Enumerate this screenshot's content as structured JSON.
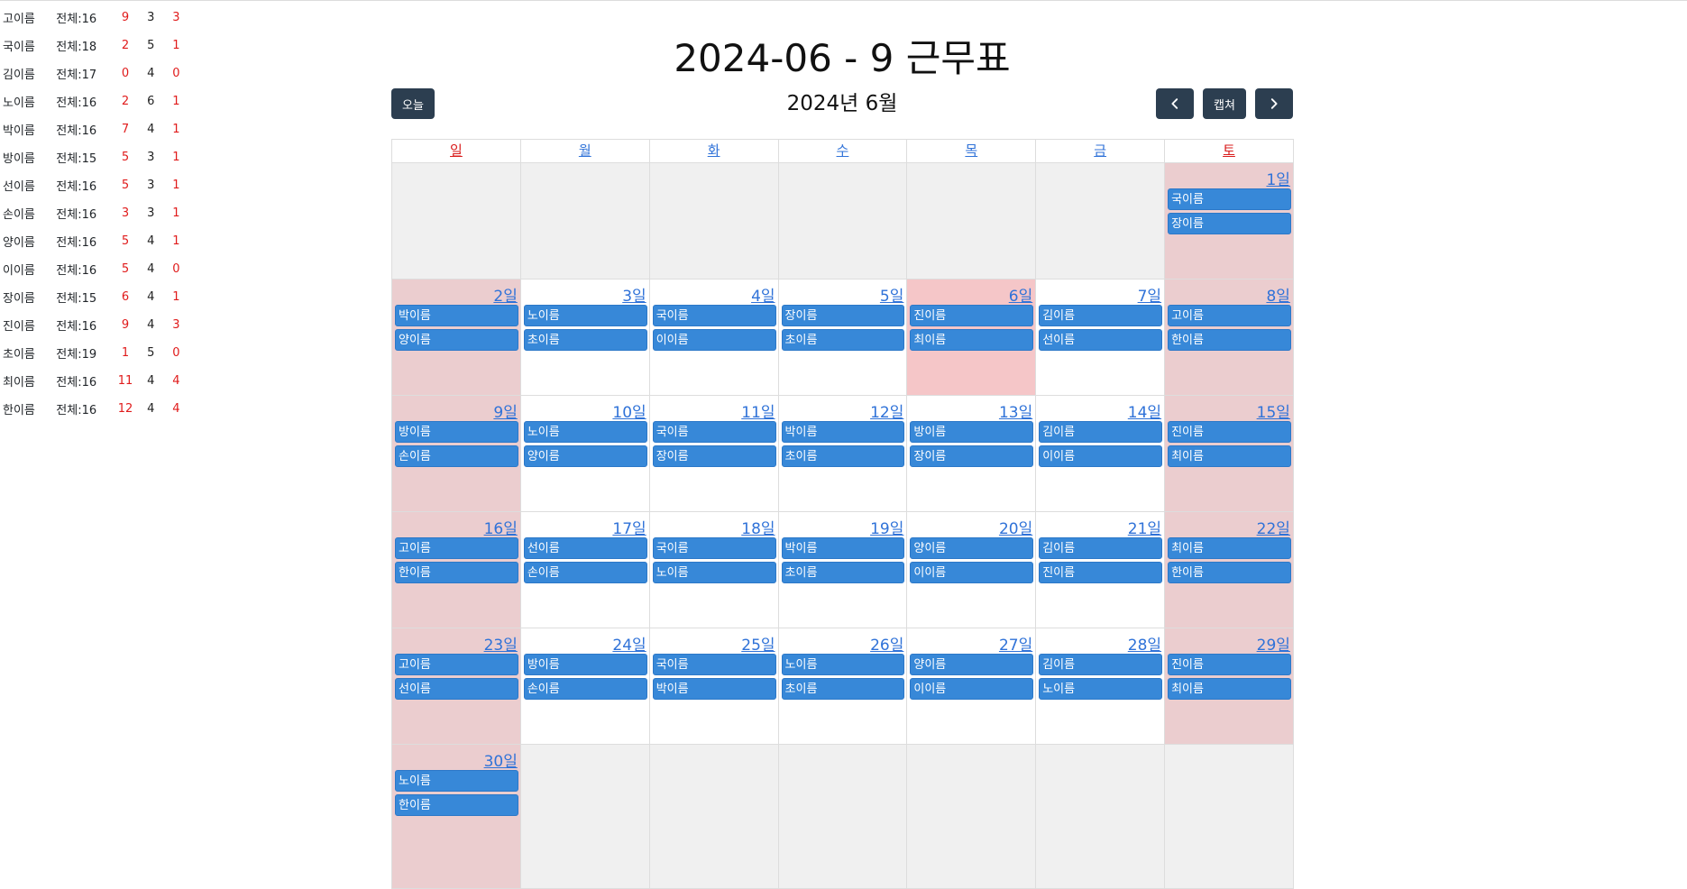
{
  "page": {
    "title": "2024-06 - 9 근무표"
  },
  "toolbar": {
    "today": "오늘",
    "capture": "캡쳐",
    "month_title": "2024년 6월"
  },
  "stats": [
    {
      "name": "고이름",
      "total": "전체:16",
      "a": "9",
      "b": "3",
      "c": "3"
    },
    {
      "name": "국이름",
      "total": "전체:18",
      "a": "2",
      "b": "5",
      "c": "1"
    },
    {
      "name": "김이름",
      "total": "전체:17",
      "a": "0",
      "b": "4",
      "c": "0"
    },
    {
      "name": "노이름",
      "total": "전체:16",
      "a": "2",
      "b": "6",
      "c": "1"
    },
    {
      "name": "박이름",
      "total": "전체:16",
      "a": "7",
      "b": "4",
      "c": "1"
    },
    {
      "name": "방이름",
      "total": "전체:15",
      "a": "5",
      "b": "3",
      "c": "1"
    },
    {
      "name": "선이름",
      "total": "전체:16",
      "a": "5",
      "b": "3",
      "c": "1"
    },
    {
      "name": "손이름",
      "total": "전체:16",
      "a": "3",
      "b": "3",
      "c": "1"
    },
    {
      "name": "양이름",
      "total": "전체:16",
      "a": "5",
      "b": "4",
      "c": "1"
    },
    {
      "name": "이이름",
      "total": "전체:16",
      "a": "5",
      "b": "4",
      "c": "0"
    },
    {
      "name": "장이름",
      "total": "전체:15",
      "a": "6",
      "b": "4",
      "c": "1"
    },
    {
      "name": "진이름",
      "total": "전체:16",
      "a": "9",
      "b": "4",
      "c": "3"
    },
    {
      "name": "초이름",
      "total": "전체:19",
      "a": "1",
      "b": "5",
      "c": "0"
    },
    {
      "name": "최이름",
      "total": "전체:16",
      "a": "11",
      "b": "4",
      "c": "4"
    },
    {
      "name": "한이름",
      "total": "전체:16",
      "a": "12",
      "b": "4",
      "c": "4"
    }
  ],
  "colors": {
    "button": "#2c3e50",
    "event": "#3788d8",
    "weekend": "#ebcdcf",
    "holiday": "#f5c6c8",
    "empty": "#f0f0f0",
    "link": "#2f72d8",
    "sunday": "#d91c1c"
  },
  "calendar": {
    "days_of_week": [
      "일",
      "월",
      "화",
      "수",
      "목",
      "금",
      "토"
    ],
    "weeks": [
      [
        null,
        null,
        null,
        null,
        null,
        null,
        {
          "label": "1일",
          "type": "weekend",
          "events": [
            "국이름",
            "장이름"
          ]
        }
      ],
      [
        {
          "label": "2일",
          "type": "weekend",
          "events": [
            "박이름",
            "양이름"
          ]
        },
        {
          "label": "3일",
          "type": "normal",
          "events": [
            "노이름",
            "초이름"
          ]
        },
        {
          "label": "4일",
          "type": "normal",
          "events": [
            "국이름",
            "이이름"
          ]
        },
        {
          "label": "5일",
          "type": "normal",
          "events": [
            "장이름",
            "초이름"
          ]
        },
        {
          "label": "6일",
          "type": "holiday",
          "events": [
            "진이름",
            "최이름"
          ]
        },
        {
          "label": "7일",
          "type": "normal",
          "events": [
            "김이름",
            "선이름"
          ]
        },
        {
          "label": "8일",
          "type": "weekend",
          "events": [
            "고이름",
            "한이름"
          ]
        }
      ],
      [
        {
          "label": "9일",
          "type": "weekend",
          "events": [
            "방이름",
            "손이름"
          ]
        },
        {
          "label": "10일",
          "type": "normal",
          "events": [
            "노이름",
            "양이름"
          ]
        },
        {
          "label": "11일",
          "type": "normal",
          "events": [
            "국이름",
            "장이름"
          ]
        },
        {
          "label": "12일",
          "type": "normal",
          "events": [
            "박이름",
            "초이름"
          ]
        },
        {
          "label": "13일",
          "type": "normal",
          "events": [
            "방이름",
            "장이름"
          ]
        },
        {
          "label": "14일",
          "type": "normal",
          "events": [
            "김이름",
            "이이름"
          ]
        },
        {
          "label": "15일",
          "type": "weekend",
          "events": [
            "진이름",
            "최이름"
          ]
        }
      ],
      [
        {
          "label": "16일",
          "type": "weekend",
          "events": [
            "고이름",
            "한이름"
          ]
        },
        {
          "label": "17일",
          "type": "normal",
          "events": [
            "선이름",
            "손이름"
          ]
        },
        {
          "label": "18일",
          "type": "normal",
          "events": [
            "국이름",
            "노이름"
          ]
        },
        {
          "label": "19일",
          "type": "normal",
          "events": [
            "박이름",
            "초이름"
          ]
        },
        {
          "label": "20일",
          "type": "normal",
          "events": [
            "양이름",
            "이이름"
          ]
        },
        {
          "label": "21일",
          "type": "normal",
          "events": [
            "김이름",
            "진이름"
          ]
        },
        {
          "label": "22일",
          "type": "weekend",
          "events": [
            "최이름",
            "한이름"
          ]
        }
      ],
      [
        {
          "label": "23일",
          "type": "weekend",
          "events": [
            "고이름",
            "선이름"
          ]
        },
        {
          "label": "24일",
          "type": "normal",
          "events": [
            "방이름",
            "손이름"
          ]
        },
        {
          "label": "25일",
          "type": "normal",
          "events": [
            "국이름",
            "박이름"
          ]
        },
        {
          "label": "26일",
          "type": "normal",
          "events": [
            "노이름",
            "초이름"
          ]
        },
        {
          "label": "27일",
          "type": "normal",
          "events": [
            "양이름",
            "이이름"
          ]
        },
        {
          "label": "28일",
          "type": "normal",
          "events": [
            "김이름",
            "노이름"
          ]
        },
        {
          "label": "29일",
          "type": "weekend",
          "events": [
            "진이름",
            "최이름"
          ]
        }
      ],
      [
        {
          "label": "30일",
          "type": "weekend",
          "events": [
            "노이름",
            "한이름"
          ]
        },
        null,
        null,
        null,
        null,
        null,
        null
      ]
    ]
  }
}
